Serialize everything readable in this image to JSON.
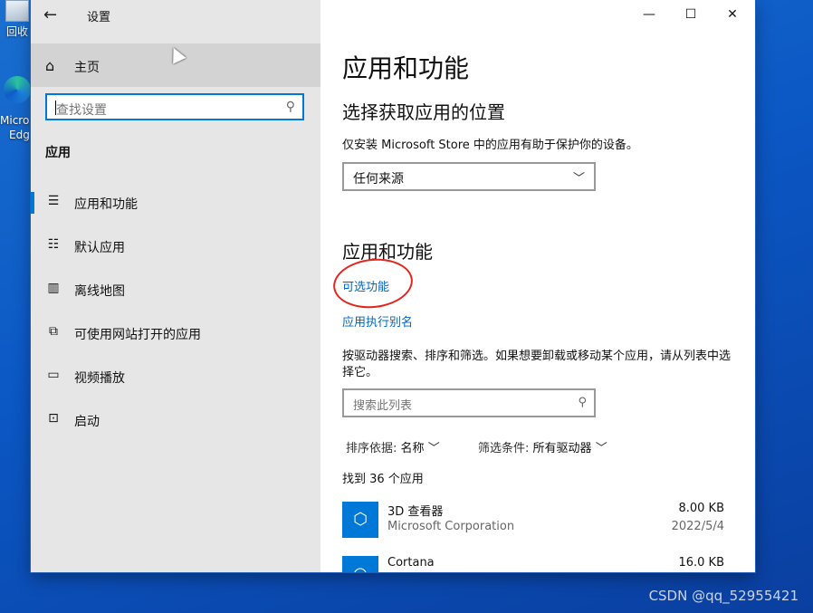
{
  "desktop": {
    "recycle_bin_label": "回收",
    "edge_label_line1": "Micros",
    "edge_label_line2": "Edg",
    "watermark": "CSDN @qq_52955421"
  },
  "window": {
    "title": "设置",
    "controls": {
      "minimize": "—",
      "maximize": "☐",
      "close": "✕"
    }
  },
  "sidebar": {
    "home_label": "主页",
    "search_placeholder": "查找设置",
    "section_label": "应用",
    "items": [
      {
        "label": "应用和功能",
        "icon": "apps-list-icon",
        "active": true
      },
      {
        "label": "默认应用",
        "icon": "default-apps-icon",
        "active": false
      },
      {
        "label": "离线地图",
        "icon": "offline-maps-icon",
        "active": false
      },
      {
        "label": "可使用网站打开的应用",
        "icon": "apps-for-websites-icon",
        "active": false
      },
      {
        "label": "视频播放",
        "icon": "video-playback-icon",
        "active": false
      },
      {
        "label": "启动",
        "icon": "startup-icon",
        "active": false
      }
    ]
  },
  "main": {
    "page_title": "应用和功能",
    "choose_location_heading": "选择获取应用的位置",
    "choose_location_desc": "仅安装 Microsoft Store 中的应用有助于保护你的设备。",
    "source_dropdown_value": "任何来源",
    "apps_heading": "应用和功能",
    "optional_features_link": "可选功能",
    "app_aliases_link": "应用执行别名",
    "search_desc": "按驱动器搜索、排序和筛选。如果想要卸载或移动某个应用，请从列表中选择它。",
    "search_list_placeholder": "搜索此列表",
    "sort_label": "排序依据:",
    "sort_value": "名称",
    "filter_label": "筛选条件:",
    "filter_value": "所有驱动器",
    "found_count": "找到 36 个应用",
    "apps": [
      {
        "name": "3D 查看器",
        "publisher": "Microsoft Corporation",
        "size": "8.00 KB",
        "date": "2022/5/4"
      },
      {
        "name": "Cortana",
        "publisher": "",
        "size": "16.0 KB",
        "date": ""
      }
    ]
  },
  "colors": {
    "accent": "#0078d7",
    "link": "#0067c0",
    "annotation": "#e3261d"
  }
}
